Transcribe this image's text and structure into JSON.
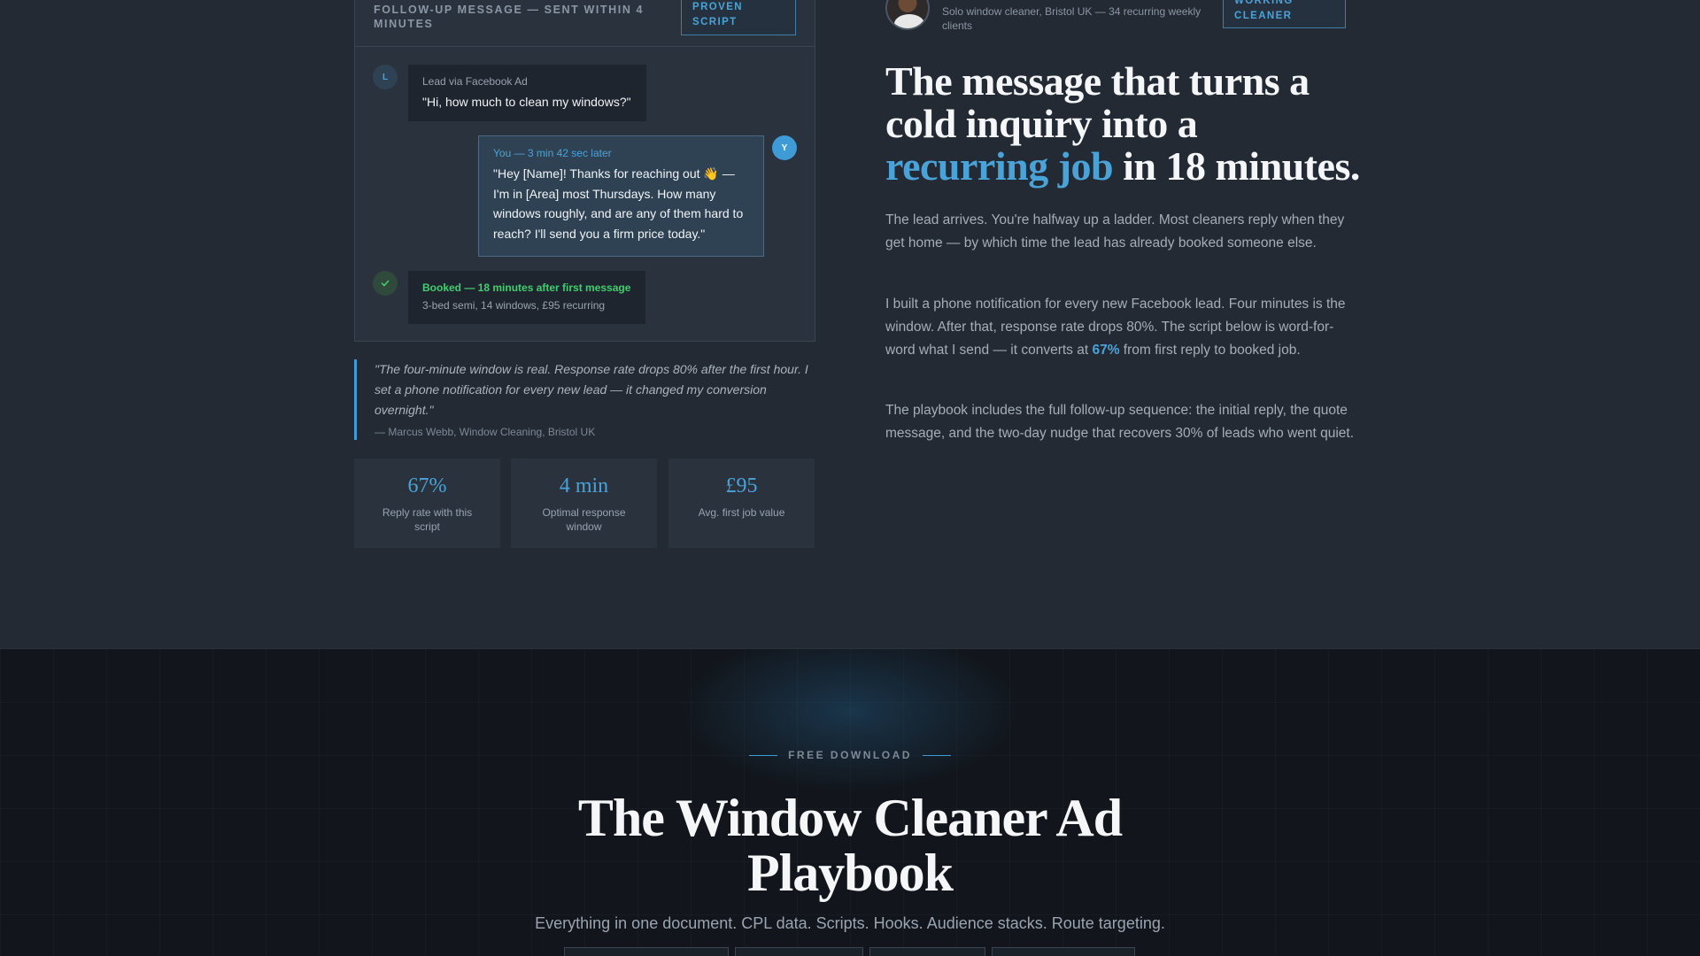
{
  "chat": {
    "header_title": "FOLLOW-UP MESSAGE — SENT WITHIN 4 MINUTES",
    "header_tag": "PROVEN SCRIPT",
    "lead_initial": "L",
    "lead_meta": "Lead via Facebook Ad",
    "lead_text": "\"Hi, how much to clean my windows?\"",
    "you_initial": "Y",
    "you_meta": "You — 3 min 42 sec later",
    "you_text": "\"Hey [Name]! Thanks for reaching out 👋 — I'm in [Area] most Thursdays. How many windows roughly, and are any of them hard to reach? I'll send you a firm price today.\"",
    "booked_title": "Booked — 18 minutes after first message",
    "booked_sub": "3-bed semi, 14 windows, £95 recurring",
    "check_icon": "check-icon"
  },
  "quote": {
    "text": "\"The four-minute window is real. Response rate drops 80% after the first hour. I set a phone notification for every new lead — it changed my conversion overnight.\"",
    "author": "— Marcus Webb, Window Cleaning, Bristol UK"
  },
  "stats": [
    {
      "value": "67%",
      "label": "Reply rate with this script"
    },
    {
      "value": "4 min",
      "label": "Optimal response window"
    },
    {
      "value": "£95",
      "label": "Avg. first job value"
    }
  ],
  "profile": {
    "subtitle": "Solo window cleaner, Bristol UK — 34 recurring weekly clients",
    "tag": "WORKING CLEANER"
  },
  "headline": {
    "part1": "The message that turns a cold inquiry into a ",
    "highlight": "recurring job",
    "part2": " in 18 minutes."
  },
  "paragraphs": {
    "p1": "The lead arrives. You're halfway up a ladder. Most cleaners reply when they get home — by which time the lead has already booked someone else.",
    "p2_before": "I built a phone notification for every new Facebook lead. Four minutes is the window. After that, response rate drops 80%. The script below is word-for-word what I send — it converts at ",
    "p2_strong": "67%",
    "p2_after": " from first reply to booked job.",
    "p3": "The playbook includes the full follow-up sequence: the initial reply, the quote message, and the two-day nudge that recovers 30% of leads who went quiet."
  },
  "download": {
    "eyebrow": "FREE DOWNLOAD",
    "title": "The Window Cleaner Ad Playbook",
    "subtitle": "Everything in one document. CPL data. Scripts. Hooks. Audience stacks. Route targeting."
  },
  "colors": {
    "accent": "#4aa3d8",
    "success": "#3fcf6e",
    "background": "#232a34",
    "bottom_background": "#12161c"
  }
}
